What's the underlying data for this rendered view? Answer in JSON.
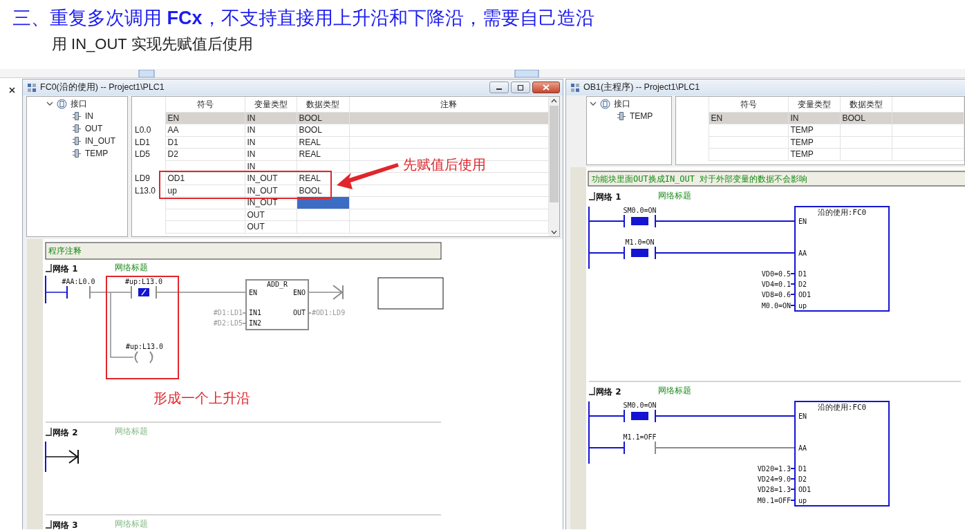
{
  "heading": "三、重复多次调用 **FCx**，不支持直接用上升沿和下降沿，需要自己造沿",
  "subheading": "用 IN_OUT 实现先赋值后使用",
  "windows": [
    {
      "title": "FC0(沿的使用) -- Project1\\PLC1",
      "window_controls": true,
      "scrollbar": true,
      "tree": {
        "label": "接口",
        "expanded": true,
        "children": [
          {
            "label": "IN"
          },
          {
            "label": "OUT"
          },
          {
            "label": "IN_OUT"
          },
          {
            "label": "TEMP"
          }
        ]
      },
      "table": {
        "columns": [
          "符号",
          "变量类型",
          "数据类型",
          "注释"
        ],
        "rows": [
          {
            "kind": "system",
            "symbol": "EN",
            "var_type": "IN",
            "data_type": "BOOL",
            "selected": false
          },
          {
            "kind": "param",
            "address": "L0.0",
            "symbol": "AA",
            "var_type": "IN",
            "data_type": "BOOL",
            "selected": false
          },
          {
            "kind": "param",
            "address": "LD1",
            "symbol": "D1",
            "var_type": "IN",
            "data_type": "REAL",
            "selected": false
          },
          {
            "kind": "param",
            "address": "LD5",
            "symbol": "D2",
            "var_type": "IN",
            "data_type": "REAL",
            "selected": false
          },
          {
            "kind": "param",
            "var_type": "IN",
            "selected": false
          },
          {
            "kind": "param",
            "address": "LD9",
            "symbol": "OD1",
            "var_type": "IN_OUT",
            "data_type": "REAL",
            "selected": false
          },
          {
            "kind": "param",
            "address": "L13.0",
            "symbol": "up",
            "var_type": "IN_OUT",
            "data_type": "BOOL",
            "selected": false
          },
          {
            "kind": "param",
            "var_type": "IN_OUT",
            "selected": true
          },
          {
            "kind": "param",
            "var_type": "OUT",
            "selected": false
          },
          {
            "kind": "param",
            "var_type": "OUT",
            "selected": false
          }
        ]
      },
      "callout": "先赋值后使用",
      "program_comment": "程序注释",
      "networks": [
        {
          "label": "网络 1",
          "title": "网络标题",
          "active": true,
          "kind": "edge_add",
          "contacts": [
            {
              "label": "#AA:L0.0",
              "on": false,
              "negated": false
            },
            {
              "label": "#up:L13.0",
              "on": true,
              "negated": true
            }
          ],
          "coil": {
            "label": "#up:L13.0"
          },
          "block": {
            "name": "ADD_R",
            "pins_left": [
              "EN",
              "IN1",
              "IN2"
            ],
            "pins_right": [
              "ENO",
              "OUT"
            ],
            "inputs": [
              "#D1:LD1",
              "#D2:LD5"
            ],
            "output": "#OD1:LD9"
          },
          "callout": "形成一个上升沿"
        },
        {
          "label": "网络 2",
          "title": "网络标题",
          "active": false,
          "kind": "empty"
        },
        {
          "label": "网络 3",
          "title": "网络标题",
          "active": false,
          "kind": "header_only"
        }
      ]
    },
    {
      "title": "OB1(主程序) -- Project1\\PLC1",
      "window_controls": false,
      "scrollbar": false,
      "tree": {
        "label": "接口",
        "expanded": true,
        "children": [
          {
            "label": "TEMP"
          }
        ]
      },
      "table": {
        "columns": [
          "符号",
          "变量类型",
          "数据类型"
        ],
        "rows": [
          {
            "kind": "system",
            "symbol": "EN",
            "var_type": "IN",
            "data_type": "BOOL",
            "selected": false
          },
          {
            "kind": "param",
            "var_type": "TEMP",
            "selected": false
          },
          {
            "kind": "param",
            "var_type": "TEMP",
            "selected": false
          },
          {
            "kind": "param",
            "var_type": "TEMP",
            "selected": false
          }
        ]
      },
      "program_comment": "功能块里面OUT换成IN_OUT 对于外部变量的数据不会影响",
      "networks": [
        {
          "label": "网络 1",
          "title": "网络标题",
          "active": true,
          "kind": "fc_call",
          "contacts": [
            {
              "label": "SM0.0=ON",
              "on": true,
              "negated": false
            },
            {
              "label": "M1.0=ON",
              "on": true,
              "negated": false
            }
          ],
          "block": {
            "name": "沿的使用:FC0",
            "pins": [
              "EN",
              "AA",
              "D1",
              "D2",
              "OD1",
              "up"
            ],
            "inputs": [
              "VD0=0.5",
              "VD4=0.1",
              "VD8=0.6",
              "M0.0=ON"
            ]
          }
        },
        {
          "label": "网络 2",
          "title": "网络标题",
          "active": true,
          "kind": "fc_call",
          "contacts": [
            {
              "label": "SM0.0=ON",
              "on": true,
              "negated": false
            },
            {
              "label": "M1.1=OFF",
              "on": false,
              "negated": false
            }
          ],
          "block": {
            "name": "沿的使用:FC0",
            "pins": [
              "EN",
              "AA",
              "D1",
              "D2",
              "OD1",
              "up"
            ],
            "inputs": [
              "VD20=1.3",
              "VD24=9.0",
              "VD28=1.3",
              "M0.1=OFF"
            ]
          }
        }
      ]
    }
  ]
}
